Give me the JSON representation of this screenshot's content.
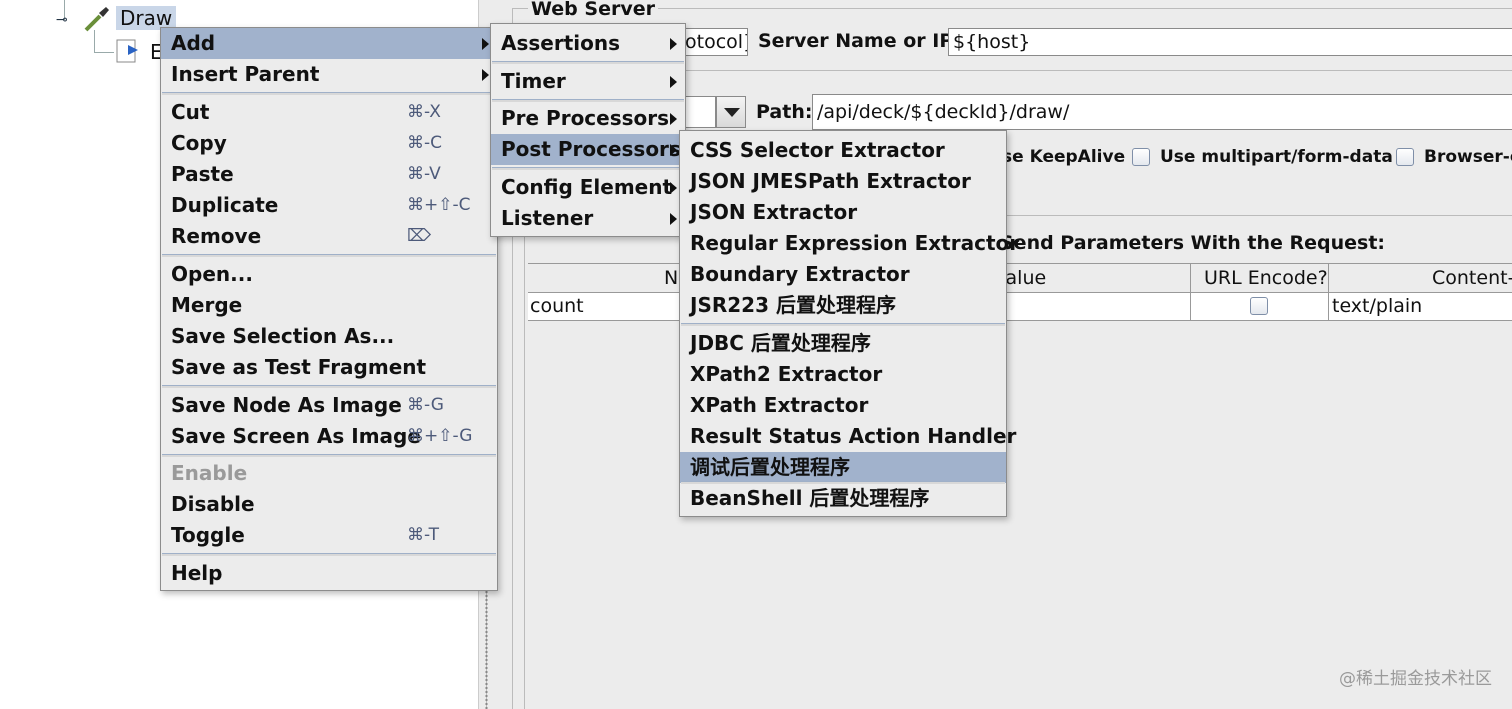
{
  "tree": {
    "node_label": "Draw",
    "child_label": "E"
  },
  "panel": {
    "web_server_title": "Web Server",
    "protocol_value": "otocol}",
    "server_label": "Server Name or IP:",
    "server_value": "${host}",
    "path_label": "Path:",
    "path_value": "/api/deck/${deckId}/draw/",
    "keepalive_label": "se KeepAlive",
    "multipart_label": "Use multipart/form-data",
    "browser_label": "Browser-c",
    "send_params_label": "Send Parameters With the Request:",
    "table": {
      "headers": [
        "N",
        "Value",
        "URL Encode?",
        "Content-"
      ],
      "rows": [
        {
          "name": "count",
          "value": "",
          "url_encode": false,
          "content_type": "text/plain"
        }
      ]
    }
  },
  "context_menu": {
    "items": [
      {
        "label": "Add",
        "submenu": true,
        "selected": true
      },
      {
        "label": "Insert Parent",
        "submenu": true
      },
      {
        "label": "Cut",
        "shortcut": "⌘-X"
      },
      {
        "label": "Copy",
        "shortcut": "⌘-C"
      },
      {
        "label": "Paste",
        "shortcut": "⌘-V"
      },
      {
        "label": "Duplicate",
        "shortcut": "⌘+⇧-C"
      },
      {
        "label": "Remove",
        "shortcut": "⌦"
      },
      {
        "label": "Open..."
      },
      {
        "label": "Merge"
      },
      {
        "label": "Save Selection As..."
      },
      {
        "label": "Save as Test Fragment"
      },
      {
        "label": "Save Node As Image",
        "shortcut": "⌘-G"
      },
      {
        "label": "Save Screen As Image",
        "shortcut": "⌘+⇧-G"
      },
      {
        "label": "Enable",
        "disabled": true
      },
      {
        "label": "Disable"
      },
      {
        "label": "Toggle",
        "shortcut": "⌘-T"
      },
      {
        "label": "Help"
      }
    ]
  },
  "add_submenu": {
    "items": [
      {
        "label": "Assertions"
      },
      {
        "label": "Timer"
      },
      {
        "label": "Pre Processors"
      },
      {
        "label": "Post Processors",
        "selected": true
      },
      {
        "label": "Config Element"
      },
      {
        "label": "Listener"
      }
    ]
  },
  "post_processors_submenu": {
    "items": [
      {
        "label": "CSS Selector Extractor"
      },
      {
        "label": "JSON JMESPath Extractor"
      },
      {
        "label": "JSON Extractor"
      },
      {
        "label": "Regular Expression Extractor"
      },
      {
        "label": "Boundary Extractor"
      },
      {
        "label": "JSR223 后置处理程序"
      },
      {
        "label": "JDBC 后置处理程序"
      },
      {
        "label": "XPath2 Extractor"
      },
      {
        "label": "XPath Extractor"
      },
      {
        "label": "Result Status Action Handler"
      },
      {
        "label": "调试后置处理程序",
        "selected": true
      },
      {
        "label": "BeanShell 后置处理程序"
      }
    ]
  },
  "watermark": "@稀土掘金技术社区"
}
